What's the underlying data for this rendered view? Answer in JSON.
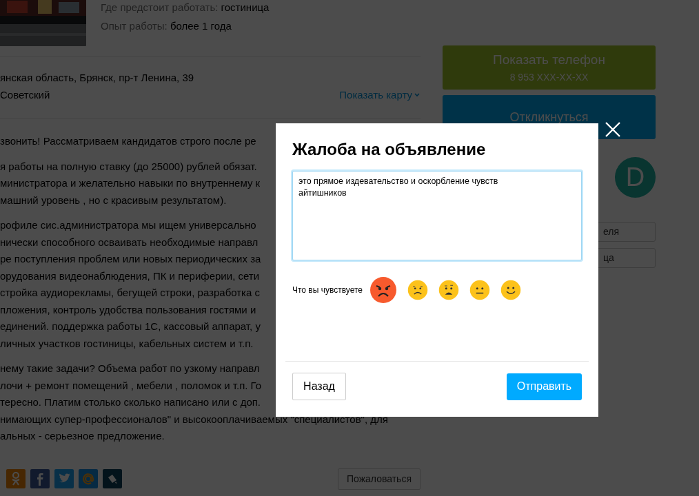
{
  "listing": {
    "details": [
      {
        "label": "Где предстоит работать:",
        "value": "гостиница"
      },
      {
        "label": "Опыт работы:",
        "value": "более 1 года"
      }
    ],
    "address": "янская область, Брянск, пр-т Ленина, 39",
    "district": "Советский",
    "map_link": "Показать карту",
    "description": [
      [
        "звонить! Рассматриваем кандидатов строго после ре"
      ],
      [
        "я работы на полную ставку (до 25000) рублей обязат.",
        "министратора и желательно навыки по внутреннему к",
        "машний уровень , но с красивым результатом)."
      ],
      [
        "рофиле сис.администратора мы ищем универсально",
        "нически способного осваивать необходимые направл",
        "ре поступления проблем или новых периодических за",
        "орудования видеонаблюдения, ПК и периферии, сети",
        "стройка аудиорекламы, бегущей строки, разработка с",
        "пложения, контроль удобства пользования гостями и",
        "единений. поддержка работы 1С, кассовый аппарат, у",
        "личных участков гостиницы, кабельных систем и т.п."
      ],
      [
        "нему такие задачи? Объема работ по узкому направл",
        "лочи + ремонт помещений , мебели , поломок и т.п. Го",
        "тересно. Платим столько сколько написано или с доп.",
        "нимающих супер-профессионалов\" и высокооплачиваемых \"специалистов\", для",
        "альных - серьезное предложение."
      ]
    ],
    "share": [
      {
        "kind": "odnoklassniki"
      },
      {
        "kind": "facebook"
      },
      {
        "kind": "twitter"
      },
      {
        "kind": "mail"
      },
      {
        "kind": "livejournal"
      }
    ],
    "report_button": "Пожаловаться"
  },
  "sidebar": {
    "phone_button": {
      "label": "Показать телефон",
      "number": "8 953 XXX-XX-XX"
    },
    "respond_button": "Откликнуться",
    "avatar_letter": "D",
    "buttons": [
      "еля",
      "ца"
    ]
  },
  "dialog": {
    "title": "Жалоба на объявление",
    "complaint": "это прямое издевательство и оскорбление чувств айтишников",
    "feelings_label": "Что вы чувствуете",
    "feelings": [
      {
        "kind": "angry",
        "selected": true
      },
      {
        "kind": "sad",
        "selected": false
      },
      {
        "kind": "shocked",
        "selected": false
      },
      {
        "kind": "neutral",
        "selected": false
      },
      {
        "kind": "smile",
        "selected": false
      }
    ],
    "back_button": "Назад",
    "send_button": "Отправить"
  }
}
